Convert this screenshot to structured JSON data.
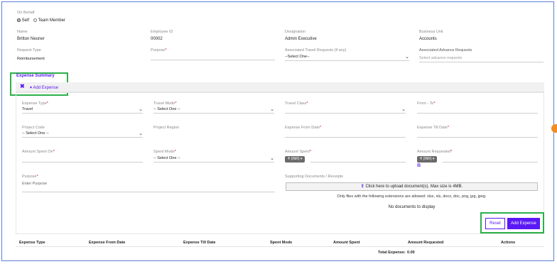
{
  "on_behalf": {
    "label": "On Behalf",
    "self": "Self",
    "team": "Team Member"
  },
  "employee": {
    "name_label": "Name",
    "name": "Britton Neuner",
    "id_label": "Employee ID",
    "id": "00002",
    "designation_label": "Designation",
    "designation": "Admin Executive",
    "bu_label": "Business Unit",
    "bu": "Accounts"
  },
  "request": {
    "type_label": "Request Type",
    "type": "Reimbursement",
    "purpose_label": "Purpose",
    "travel_label": "Associated Travel Requests (if any)",
    "travel_value": "--Select One--",
    "advance_label": "Associated Advance Requests",
    "advance_placeholder": "Select advance requests"
  },
  "summary": {
    "title": "Expense Summary",
    "add_label": "Add Expense"
  },
  "form": {
    "expense_type_label": "Expense Type",
    "expense_type": "Travel",
    "travel_mode_label": "Travel Mode",
    "travel_mode": "-- Select One --",
    "travel_class_label": "Travel Class",
    "from_to_label": "From - To",
    "project_code_label": "Project Code",
    "project_code": "-- Select One --",
    "project_region_label": "Project Region",
    "from_date_label": "Expense From Date",
    "till_date_label": "Expense Till Date",
    "spent_on_label": "Amount Spent On",
    "spent_mode_label": "Spent Mode",
    "spent_mode": "-- Select One --",
    "amount_spent_label": "Amount Spent",
    "amount_spent_currency": "₹ (INR)",
    "amount_req_label": "Amount Requested",
    "amount_req_currency": "₹ (INR)",
    "purpose_label": "Purpose",
    "purpose_placeholder": "Enter Purpose",
    "docs_label": "Supporting Documents / Receipts",
    "upload_label": "Click here to upload document(s). Max size is 4MB.",
    "ext_note": "Only files with the following extensions are allowed: xlsx, xls, docx, doc, png, jpg, jpeg.",
    "no_docs": "No documents to display",
    "reset": "Reset",
    "add": "Add Expense"
  },
  "table": {
    "headers": [
      "Expense Type",
      "Expense From Date",
      "Expense Till Date",
      "Spent Mode",
      "Amount Spent",
      "Amount Requested",
      "Actions"
    ],
    "total_label": "Total Expense:",
    "total_value": "0.00"
  },
  "colors": {
    "accent": "#5a19f5",
    "highlight": "#2bb04a"
  }
}
